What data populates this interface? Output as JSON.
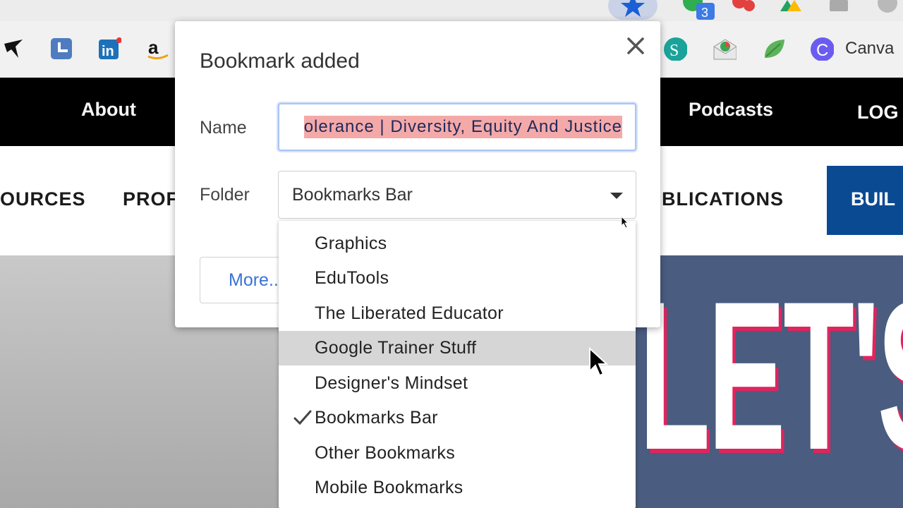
{
  "bookmarks_bar": {
    "profile_canvas_label": "Canva",
    "notification_count": "3"
  },
  "site": {
    "nav": [
      "About",
      "Podcasts",
      "LOG"
    ],
    "subnav": [
      "OURCES",
      "PROF",
      "BLICATIONS"
    ],
    "build_button": "BUIL",
    "hero_text": "LET'S"
  },
  "dialog": {
    "title": "Bookmark added",
    "name_label": "Name",
    "name_value": "olerance | Diversity, Equity And Justice",
    "folder_label": "Folder",
    "folder_value": "Bookmarks Bar",
    "more_button": "More..."
  },
  "dropdown": {
    "options": [
      "Graphics",
      "EduTools",
      "The Liberated Educator",
      "Google Trainer Stuff",
      "Designer's Mindset",
      "Bookmarks Bar",
      "Other Bookmarks",
      "Mobile Bookmarks"
    ],
    "highlighted": "Google Trainer Stuff",
    "selected": "Bookmarks Bar"
  },
  "colors": {
    "nav_bg": "#000000",
    "build_bg": "#0a4a93",
    "selection_highlight": "#f4a9a9",
    "focus_ring": "#a8c4f6",
    "link_blue": "#3a72d6",
    "hover_row": "#d6d6d6",
    "hero_accent": "#e0245e"
  }
}
